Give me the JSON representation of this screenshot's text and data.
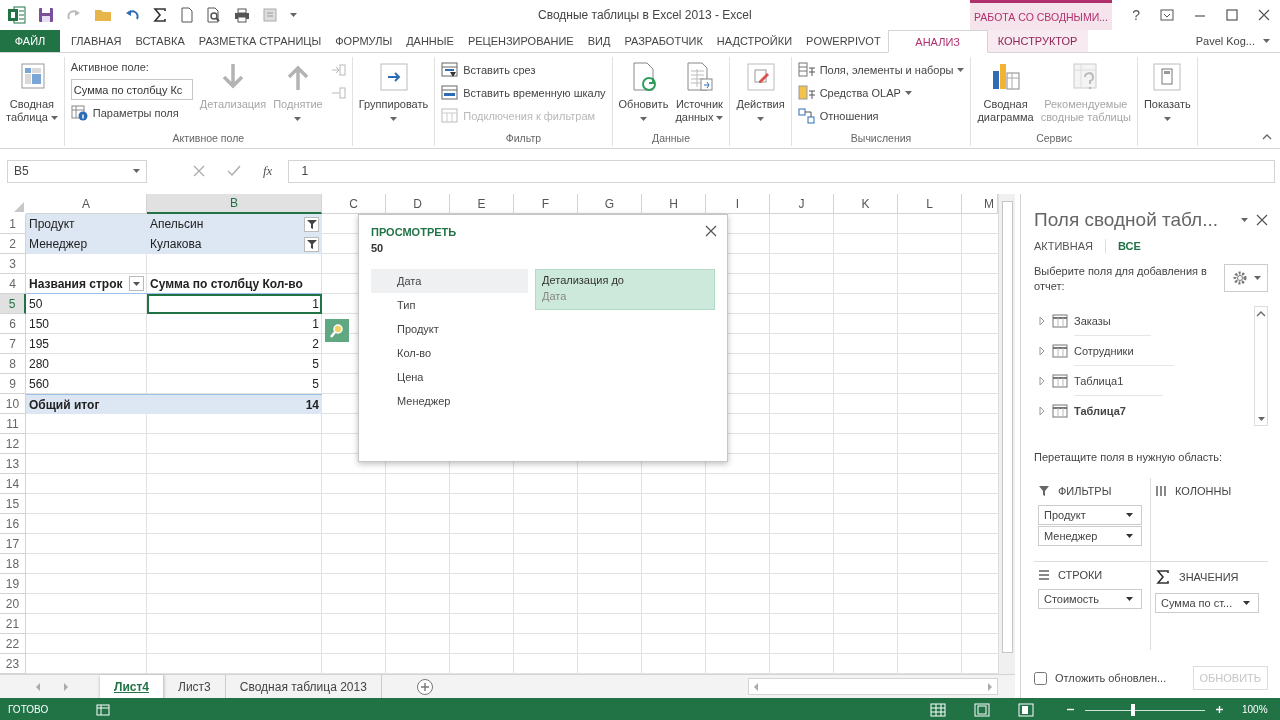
{
  "window": {
    "title": "Сводные таблицы в Excel 2013 - Excel",
    "context_label": "РАБОТА СО СВОДНЫМИ...",
    "help_button": "?"
  },
  "tabs": [
    {
      "label": "ФАЙЛ",
      "kind": "file",
      "selected": false
    },
    {
      "label": "ГЛАВНАЯ",
      "kind": "normal",
      "selected": false
    },
    {
      "label": "ВСТАВКА",
      "kind": "normal",
      "selected": false
    },
    {
      "label": "РАЗМЕТКА СТРАНИЦЫ",
      "kind": "normal",
      "selected": false
    },
    {
      "label": "ФОРМУЛЫ",
      "kind": "normal",
      "selected": false
    },
    {
      "label": "ДАННЫЕ",
      "kind": "normal",
      "selected": false
    },
    {
      "label": "РЕЦЕНЗИРОВАНИЕ",
      "kind": "normal",
      "selected": false
    },
    {
      "label": "ВИД",
      "kind": "normal",
      "selected": false
    },
    {
      "label": "РАЗРАБОТЧИК",
      "kind": "normal",
      "selected": false
    },
    {
      "label": "НАДСТРОЙКИ",
      "kind": "normal",
      "selected": false
    },
    {
      "label": "POWERPIVOT",
      "kind": "normal",
      "selected": false
    },
    {
      "label": "АНАЛИЗ",
      "kind": "context",
      "selected": true
    },
    {
      "label": "КОНСТРУКТОР",
      "kind": "context",
      "selected": false
    }
  ],
  "user": "Pavel Kog...",
  "ribbon": {
    "groups": [
      {
        "items": [
          {
            "kind": "large",
            "lines": [
              "Сводная",
              "таблица"
            ],
            "disabled": false,
            "dropdown": true
          }
        ]
      },
      {
        "label": "Активное поле",
        "items": [
          {
            "kind": "field",
            "label": "Активное поле:",
            "value": "Сумма по столбцу Кс"
          },
          {
            "kind": "small",
            "label": "Параметры поля",
            "disabled": false,
            "dropdown": false
          },
          {
            "kind": "large",
            "lines": [
              "Детализация"
            ],
            "disabled": true,
            "dropdown": false
          },
          {
            "kind": "large",
            "lines": [
              "Поднятие"
            ],
            "disabled": true,
            "dropdown": true
          },
          {
            "kind": "small",
            "disabled": true,
            "dropdown": false
          },
          {
            "kind": "small",
            "disabled": true,
            "dropdown": false
          }
        ]
      },
      {
        "items": [
          {
            "kind": "large",
            "lines": [
              "Группировать"
            ],
            "disabled": false,
            "dropdown": true
          }
        ]
      },
      {
        "label": "Фильтр",
        "items": [
          {
            "kind": "small",
            "label": "Вставить срез",
            "disabled": false,
            "dropdown": false
          },
          {
            "kind": "small",
            "label": "Вставить временную шкалу",
            "disabled": false,
            "dropdown": false
          },
          {
            "kind": "small",
            "label": "Подключения к фильтрам",
            "disabled": true,
            "dropdown": false
          }
        ]
      },
      {
        "label": "Данные",
        "items": [
          {
            "kind": "large",
            "lines": [
              "Обновить"
            ],
            "disabled": false,
            "dropdown": true
          },
          {
            "kind": "large",
            "lines": [
              "Источник",
              "данных"
            ],
            "disabled": false,
            "dropdown": true
          }
        ]
      },
      {
        "items": [
          {
            "kind": "large",
            "lines": [
              "Действия"
            ],
            "disabled": false,
            "dropdown": true
          }
        ]
      },
      {
        "label": "Вычисления",
        "items": [
          {
            "kind": "small",
            "label": "Поля, элементы и наборы",
            "disabled": false,
            "dropdown": true
          },
          {
            "kind": "small",
            "label": "Средства OLAP",
            "disabled": false,
            "dropdown": true
          },
          {
            "kind": "small",
            "label": "Отношения",
            "disabled": false,
            "dropdown": false
          }
        ]
      },
      {
        "label": "Сервис",
        "items": [
          {
            "kind": "large",
            "lines": [
              "Сводная",
              "диаграмма"
            ],
            "disabled": false,
            "dropdown": false
          },
          {
            "kind": "large",
            "lines": [
              "Рекомендуемые",
              "сводные таблицы"
            ],
            "disabled": true,
            "dropdown": false
          }
        ]
      },
      {
        "items": [
          {
            "kind": "large",
            "lines": [
              "Показать"
            ],
            "disabled": false,
            "dropdown": true
          }
        ]
      }
    ]
  },
  "formula_bar": {
    "name_box": "B5",
    "function_label": "fx",
    "formula": "1"
  },
  "sheet": {
    "columns": [
      {
        "label": "A",
        "selected": false
      },
      {
        "label": "B",
        "selected": true
      },
      {
        "label": "C",
        "selected": false
      },
      {
        "label": "D",
        "selected": false
      },
      {
        "label": "E",
        "selected": false
      },
      {
        "label": "F",
        "selected": false
      },
      {
        "label": "G",
        "selected": false
      },
      {
        "label": "H",
        "selected": false
      },
      {
        "label": "I",
        "selected": false
      },
      {
        "label": "J",
        "selected": false
      },
      {
        "label": "K",
        "selected": false
      },
      {
        "label": "L",
        "selected": false
      },
      {
        "label": "M",
        "selected": false
      }
    ],
    "rows": [
      {
        "label": "1",
        "kind": "filter",
        "selected": false,
        "cells": [
          {
            "text": "Продукт",
            "kind": "text",
            "selected": false
          },
          {
            "text": "Апельсин",
            "kind": "filter",
            "selected": false
          }
        ]
      },
      {
        "label": "2",
        "kind": "filter",
        "selected": false,
        "cells": [
          {
            "text": "Менеджер",
            "kind": "text",
            "selected": false
          },
          {
            "text": "Кулакова",
            "kind": "filter",
            "selected": false
          }
        ]
      },
      {
        "label": "3",
        "kind": "blank",
        "selected": false
      },
      {
        "label": "4",
        "kind": "header",
        "selected": false,
        "cells": [
          {
            "text": "Названия строк",
            "kind": "dropdown",
            "selected": false
          },
          {
            "text": "Сумма по столбцу Кол-во",
            "kind": "text",
            "selected": false
          }
        ]
      },
      {
        "label": "5",
        "kind": "data",
        "selected": true,
        "cells": [
          {
            "text": "50",
            "kind": "text",
            "selected": false
          },
          {
            "text": "1",
            "kind": "text",
            "selected": true
          }
        ]
      },
      {
        "label": "6",
        "kind": "data",
        "selected": false,
        "cells": [
          {
            "text": "150",
            "kind": "text",
            "selected": false
          },
          {
            "text": "1",
            "kind": "text",
            "selected": false
          }
        ]
      },
      {
        "label": "7",
        "kind": "data",
        "selected": false,
        "cells": [
          {
            "text": "195",
            "kind": "text",
            "selected": false
          },
          {
            "text": "2",
            "kind": "text",
            "selected": false
          }
        ]
      },
      {
        "label": "8",
        "kind": "data",
        "selected": false,
        "cells": [
          {
            "text": "280",
            "kind": "text",
            "selected": false
          },
          {
            "text": "5",
            "kind": "text",
            "selected": false
          }
        ]
      },
      {
        "label": "9",
        "kind": "data",
        "selected": false,
        "cells": [
          {
            "text": "560",
            "kind": "text",
            "selected": false
          },
          {
            "text": "5",
            "kind": "text",
            "selected": false
          }
        ]
      },
      {
        "label": "10",
        "kind": "total",
        "selected": false,
        "cells": [
          {
            "text": "Общий итог",
            "kind": "text",
            "selected": false
          },
          {
            "text": "14",
            "kind": "text",
            "selected": false
          }
        ]
      },
      {
        "label": "11",
        "kind": "blank",
        "selected": false
      },
      {
        "label": "12",
        "kind": "blank",
        "selected": false
      },
      {
        "label": "13",
        "kind": "blank",
        "selected": false
      },
      {
        "label": "14",
        "kind": "blank",
        "selected": false
      },
      {
        "label": "15",
        "kind": "blank",
        "selected": false
      },
      {
        "label": "16",
        "kind": "blank",
        "selected": false
      },
      {
        "label": "17",
        "kind": "blank",
        "selected": false
      },
      {
        "label": "18",
        "kind": "blank",
        "selected": false
      },
      {
        "label": "19",
        "kind": "blank",
        "selected": false
      },
      {
        "label": "20",
        "kind": "blank",
        "selected": false
      },
      {
        "label": "21",
        "kind": "blank",
        "selected": false
      },
      {
        "label": "22",
        "kind": "blank",
        "selected": false
      },
      {
        "label": "23",
        "kind": "blank",
        "selected": false
      }
    ]
  },
  "popup": {
    "title": "ПРОСМОТРЕТЬ",
    "value": "50",
    "fields": [
      {
        "label": "Дата",
        "selected": true
      },
      {
        "label": "Тип",
        "selected": false
      },
      {
        "label": "Продукт",
        "selected": false
      },
      {
        "label": "Кол-во",
        "selected": false
      },
      {
        "label": "Цена",
        "selected": false
      },
      {
        "label": "Менеджер",
        "selected": false
      }
    ],
    "drill": {
      "label": "Детализация до",
      "value": "Дата"
    }
  },
  "pane": {
    "title": "Поля сводной табл...",
    "tabs": [
      {
        "label": "АКТИВНАЯ",
        "selected": false
      },
      {
        "label": "ВСЕ",
        "selected": true
      }
    ],
    "hint": "Выберите поля для добавления в отчет:",
    "tables": [
      {
        "label": "Заказы",
        "in_use": false
      },
      {
        "label": "Сотрудники",
        "in_use": false
      },
      {
        "label": "Таблица1",
        "in_use": false
      },
      {
        "label": "Таблица7",
        "in_use": true
      }
    ],
    "drag_hint": "Перетащите поля в нужную область:",
    "areas": [
      {
        "kind": "filters",
        "label": "ФИЛЬТРЫ",
        "fields": [
          "Продукт",
          "Менеджер"
        ]
      },
      {
        "kind": "columns",
        "label": "КОЛОННЫ"
      },
      {
        "kind": "rows",
        "label": "СТРОКИ",
        "fields": [
          "Стоимость"
        ]
      },
      {
        "kind": "values",
        "label": "ЗНАЧЕНИЯ",
        "fields": [
          "Сумма по ст..."
        ]
      }
    ],
    "defer": {
      "label": "Отложить обновлен...",
      "checked": false
    },
    "update_button": {
      "label": "ОБНОВИТЬ",
      "disabled": true
    }
  },
  "sheet_tabs": [
    {
      "label": "Лист4",
      "selected": true
    },
    {
      "label": "Лист3",
      "selected": false
    },
    {
      "label": "Сводная таблица 2013",
      "selected": false
    }
  ],
  "status": {
    "text": "ГОТОВО",
    "zoom": {
      "label": "100%",
      "level": 0.4
    }
  }
}
